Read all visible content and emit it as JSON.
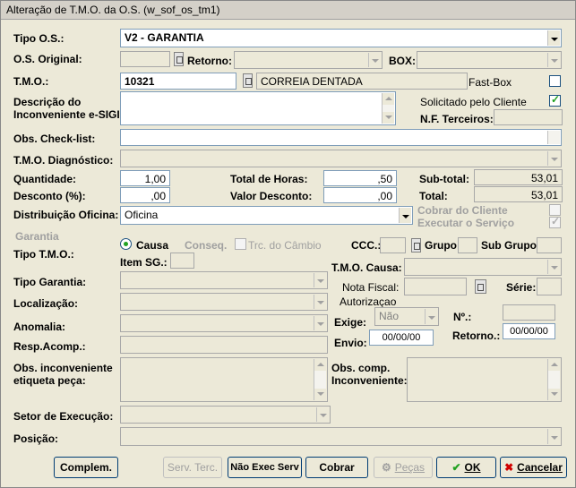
{
  "window": {
    "title": "Alteração de T.M.O. da O.S. (w_sof_os_tm1)"
  },
  "labels": {
    "tipo_os": "Tipo O.S.:",
    "os_original": "O.S. Original:",
    "retorno": "Retorno:",
    "box": "BOX:",
    "tmo": "T.M.O.:",
    "fast_box": "Fast-Box",
    "descricao_line1": "Descrição do",
    "descricao_line2": "Inconveniente e-SIGI",
    "solicitado": "Solicitado pelo Cliente",
    "nf_terceiros": "N.F. Terceiros:",
    "obs_checklist": "Obs. Check-list:",
    "tmo_diagnostico": "T.M.O. Diagnóstico:",
    "quantidade": "Quantidade:",
    "total_horas": "Total de Horas:",
    "subtotal": "Sub-total:",
    "desconto": "Desconto (%):",
    "valor_desconto": "Valor Desconto:",
    "total": "Total:",
    "distribuicao": "Distribuição Oficina:",
    "cobrar_cliente": "Cobrar do Cliente",
    "executar_servico": "Executar o Serviço",
    "garantia": "Garantia",
    "tipo_tmo": "Tipo T.M.O.:",
    "causa": "Causa",
    "conseq": "Conseq.",
    "trc_cambio": "Trc. do Câmbio",
    "ccc": "CCC.:",
    "grupo": "Grupo:",
    "sub_grupo": "Sub Grupo:",
    "item_sg": "Item SG.:",
    "tipo_garantia": "Tipo Garantia:",
    "tmo_causa": "T.M.O. Causa:",
    "nota_fiscal": "Nota Fiscal:",
    "serie": "Série:",
    "localizacao": "Localização:",
    "autorizacao": "Autorizaçao",
    "exige": "Exige:",
    "numero": "Nº.:",
    "anomalia": "Anomalia:",
    "envio": "Envio:",
    "retorno2": "Retorno.:",
    "resp_acomp": "Resp.Acomp.:",
    "obs_inconveniente_line1": "Obs. inconveniente",
    "obs_inconveniente_line2": "etiqueta peça:",
    "obs_comp_line1": "Obs. comp.",
    "obs_comp_line2": "Inconveniente:",
    "setor_execucao": "Setor de Execução:",
    "posicao": "Posição:"
  },
  "values": {
    "tipo_os": "V2 - GARANTIA",
    "tmo_code": "10321",
    "tmo_desc": "CORREIA DENTADA",
    "quantidade": "1,00",
    "total_horas": ",50",
    "subtotal": "53,01",
    "desconto": ",00",
    "valor_desconto": ",00",
    "total": "53,01",
    "distribuicao": "Oficina",
    "exige": "Não",
    "envio": "00/00/00",
    "retorno": "00/00/00"
  },
  "checks": {
    "fast_box": false,
    "solicitado": true,
    "cobrar_cliente": false,
    "executar_servico": true
  },
  "buttons": {
    "complem": "Complem.",
    "serv_terc": "Serv. Terc.",
    "nao_exec_serv": "Não Exec Serv",
    "cobrar": "Cobrar",
    "pecas": "Peças",
    "ok": "OK",
    "cancelar": "Cancelar"
  },
  "colors": {
    "window_bg": "#ece9d8",
    "field_border": "#7f9db9",
    "check_green": "#21a121",
    "cancel_red": "#d00000"
  }
}
